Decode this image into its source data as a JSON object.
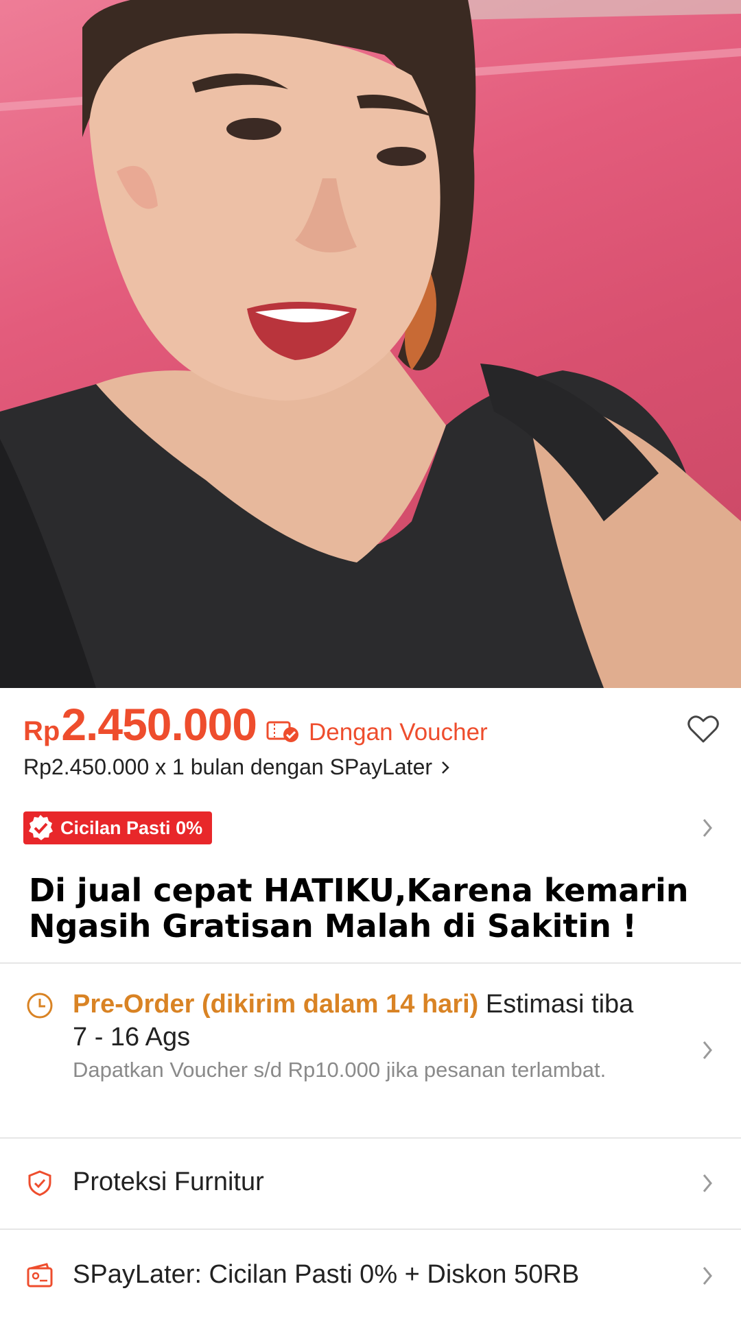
{
  "product": {
    "price_currency": "Rp",
    "price_value": "2.450.000",
    "voucher_label": "Dengan Voucher",
    "spaylater_line": "Rp2.450.000 x 1 bulan dengan SPayLater",
    "cicilan_badge": "Cicilan Pasti 0%",
    "title_line1": "Di jual cepat HATIKU,Karena kemarin",
    "title_line2": "Ngasih Gratisan Malah di Sakitin !"
  },
  "shipping": {
    "preorder_label": "Pre-Order (dikirim dalam 14 hari)",
    "estimate_label": "Estimasi tiba",
    "estimate_dates": "7 - 16 Ags",
    "late_notice": "Dapatkan Voucher s/d Rp10.000 jika pesanan terlambat."
  },
  "rows": {
    "protection_label": "Proteksi Furnitur",
    "spaylater_promo_label": "SPayLater: Cicilan Pasti 0% + Diskon 50RB"
  },
  "colors": {
    "accent": "#ee4d2d",
    "badge": "#e8272a",
    "preorder": "#d98324"
  },
  "icons": {
    "voucher": "ticket-check-icon",
    "favorite": "heart-icon",
    "shipping": "clock-icon",
    "protection": "shield-check-icon",
    "spaylater": "card-wallet-icon"
  }
}
